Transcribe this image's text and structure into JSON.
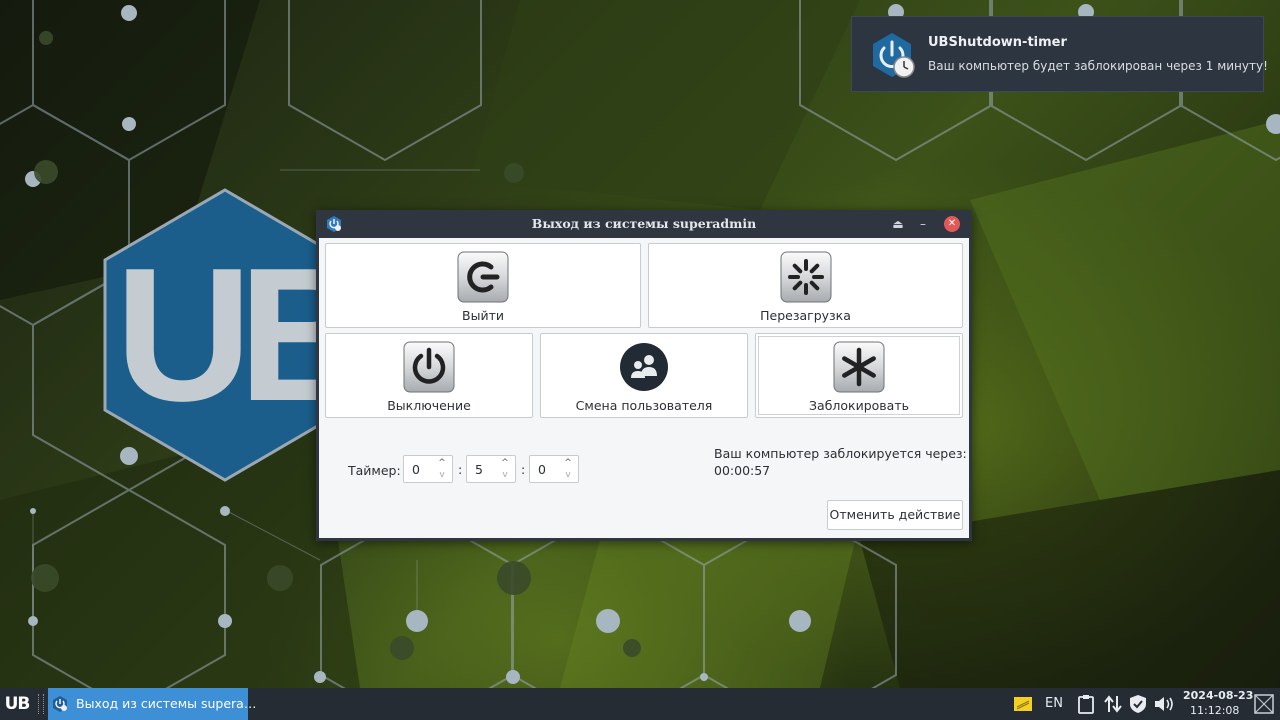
{
  "notification": {
    "title": "UBShutdown-timer",
    "body": "Ваш компьютер будет заблокирован через 1 минуту!",
    "icon": "power-clock-icon"
  },
  "window": {
    "title": "Выход из системы superadmin",
    "controls": [
      "shade-icon",
      "minimize-icon",
      "close-icon"
    ],
    "actions": {
      "logout": "Выйти",
      "reboot": "Перезагрузка",
      "shutdown": "Выключение",
      "switch_user": "Смена пользователя",
      "lock": "Заблокировать"
    },
    "timer": {
      "label": "Таймер:",
      "hours": "0",
      "minutes": "5",
      "seconds": "0",
      "separator": ":"
    },
    "countdown": {
      "message": "Ваш компьютер заблокируется через:",
      "remaining": "00:00:57"
    },
    "cancel_label": "Отменить действие"
  },
  "wallpaper": {
    "logo_text": "UB"
  },
  "taskbar": {
    "start_label": "UB",
    "task_label": "Выход из системы supera…",
    "language": "EN",
    "date": "2024-08-23",
    "time": "11:12:08"
  },
  "colors": {
    "accent": "#3d8fd6",
    "close": "#e05a5a",
    "panel": "#262c34",
    "logo_blue": "#1b5e8c"
  }
}
